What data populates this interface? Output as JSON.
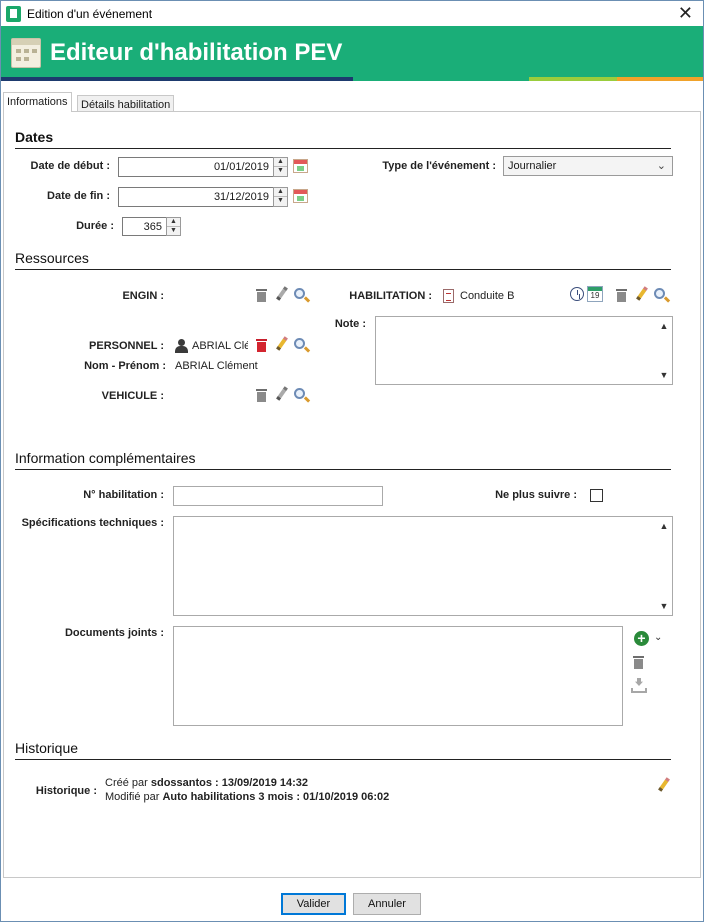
{
  "window": {
    "title": "Edition d'un événement"
  },
  "banner": {
    "title": "Editeur d'habilitation PEV"
  },
  "colors": {
    "banner": "#1aae78",
    "stripe_navy": "#1d3a6e",
    "stripe_green": "#1aae78",
    "stripe_lime": "#9acd3c",
    "stripe_orange": "#f0a22a",
    "delete_red": "#d3252f"
  },
  "tabs": [
    {
      "label": "Informations"
    },
    {
      "label": "Détails habilitation"
    }
  ],
  "dates": {
    "title": "Dates",
    "start_label": "Date de début :",
    "start_value": "01/01/2019",
    "end_label": "Date de fin :",
    "end_value": "31/12/2019",
    "duration_label": "Durée :",
    "duration_value": "365",
    "event_type_label": "Type de l'événement :",
    "event_type_value": "Journalier"
  },
  "resources": {
    "title": "Ressources",
    "engin_label": "ENGIN :",
    "habilitation_label": "HABILITATION :",
    "habilitation_value": "Conduite B",
    "note_label": "Note :",
    "personnel_label": "PERSONNEL :",
    "personnel_value": "ABRIAL Clé",
    "name_label": "Nom - Prénom :",
    "name_value": "ABRIAL Clément",
    "vehicule_label": "VEHICULE :",
    "calendar_day": "19"
  },
  "complementary": {
    "title": "Information complémentaires",
    "number_label": "N° habilitation :",
    "number_value": "",
    "stop_follow_label": "Ne plus suivre :",
    "stop_follow_checked": false,
    "specs_label": "Spécifications techniques :",
    "documents_label": "Documents joints :"
  },
  "history": {
    "title": "Historique",
    "label": "Historique :",
    "created_prefix": "Créé par",
    "created_detail": "sdossantos : 13/09/2019 14:32",
    "modified_prefix": "Modifié par",
    "modified_detail": "Auto habilitations  3 mois : 01/10/2019 06:02"
  },
  "buttons": {
    "validate": "Valider",
    "cancel": "Annuler"
  }
}
